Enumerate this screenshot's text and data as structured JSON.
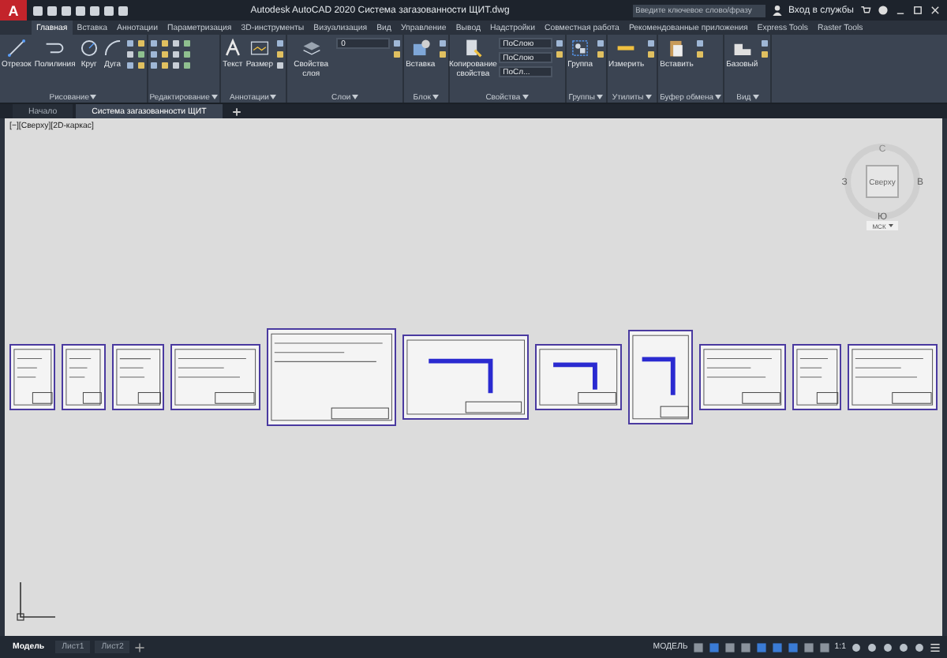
{
  "title_bar": {
    "app_logo": "A",
    "title": "Autodesk AutoCAD 2020   Система загазованности ЩИТ.dwg",
    "search_placeholder": "Введите ключевое слово/фразу",
    "sign_in": "Вход в службы"
  },
  "ribbon_tabs": [
    {
      "label": "Главная",
      "selected": true
    },
    {
      "label": "Вставка",
      "selected": false
    },
    {
      "label": "Аннотации",
      "selected": false
    },
    {
      "label": "Параметризация",
      "selected": false
    },
    {
      "label": "3D-инструменты",
      "selected": false
    },
    {
      "label": "Визуализация",
      "selected": false
    },
    {
      "label": "Вид",
      "selected": false
    },
    {
      "label": "Управление",
      "selected": false
    },
    {
      "label": "Вывод",
      "selected": false
    },
    {
      "label": "Надстройки",
      "selected": false
    },
    {
      "label": "Совместная работа",
      "selected": false
    },
    {
      "label": "Рекомендованные приложения",
      "selected": false
    },
    {
      "label": "Express Tools",
      "selected": false
    },
    {
      "label": "Raster Tools",
      "selected": false
    }
  ],
  "ribbon_panels": [
    {
      "title": "Рисование",
      "tools": [
        {
          "label": "Отрезок",
          "kind": "line"
        },
        {
          "label": "Полилиния",
          "kind": "polyline"
        },
        {
          "label": "Круг",
          "kind": "circle"
        },
        {
          "label": "Дуга",
          "kind": "arc"
        }
      ]
    },
    {
      "title": "Редактирование"
    },
    {
      "title": "Аннотации",
      "tools": [
        {
          "label": "Текст",
          "kind": "text"
        },
        {
          "label": "Размер",
          "kind": "dimension"
        }
      ]
    },
    {
      "title": "Слои",
      "tools": [
        {
          "label": "Свойства слоя",
          "kind": "layers"
        }
      ],
      "fields": [
        {
          "value": "0"
        }
      ]
    },
    {
      "title": "Блок",
      "tools": [
        {
          "label": "Вставка",
          "kind": "insert"
        }
      ]
    },
    {
      "title": "Свойства",
      "tools": [
        {
          "label": "Копирование свойства",
          "kind": "match"
        }
      ],
      "fields": [
        {
          "value": "ПоСлою"
        },
        {
          "value": "ПоСлою"
        },
        {
          "value": "ПоСл..."
        }
      ]
    },
    {
      "title": "Группы",
      "tools": [
        {
          "label": "Группа",
          "kind": "group"
        }
      ]
    },
    {
      "title": "Утилиты",
      "tools": [
        {
          "label": "Измерить",
          "kind": "measure"
        }
      ]
    },
    {
      "title": "Буфер обмена",
      "tools": [
        {
          "label": "Вставить",
          "kind": "paste"
        }
      ]
    },
    {
      "title": "Вид",
      "tools": [
        {
          "label": "Базовый",
          "kind": "view"
        }
      ]
    }
  ],
  "document_tabs": [
    {
      "label": "Начало",
      "selected": false
    },
    {
      "label": "Система загазованности ЩИТ",
      "selected": true
    }
  ],
  "viewport": {
    "label": "[−][Сверху][2D-каркас]",
    "viewcube": {
      "north": "С",
      "west": "З",
      "east": "В",
      "south": "Ю",
      "face": "Сверху",
      "ucs": "МСК"
    }
  },
  "layout_tabs": [
    {
      "label": "Модель",
      "selected": true
    },
    {
      "label": "Лист1",
      "selected": false
    },
    {
      "label": "Лист2",
      "selected": false
    }
  ],
  "status_bar": {
    "mode": "МОДЕЛЬ",
    "scale": "1:1"
  }
}
